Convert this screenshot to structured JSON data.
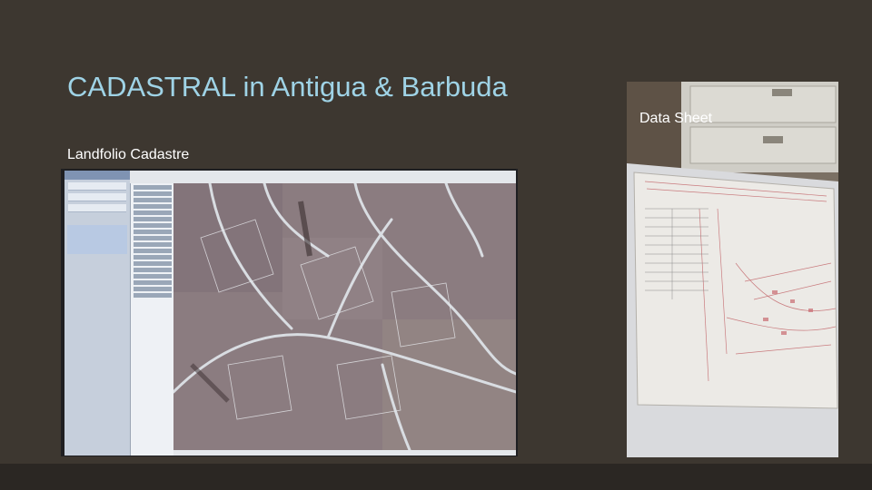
{
  "slide": {
    "title": "CADASTRAL in Antigua & Barbuda",
    "left_caption": "Landfolio Cadastre",
    "right_caption": "Data Sheet"
  },
  "colors": {
    "background": "#3d3730",
    "title": "#9fd3e6",
    "caption": "#ffffff"
  }
}
